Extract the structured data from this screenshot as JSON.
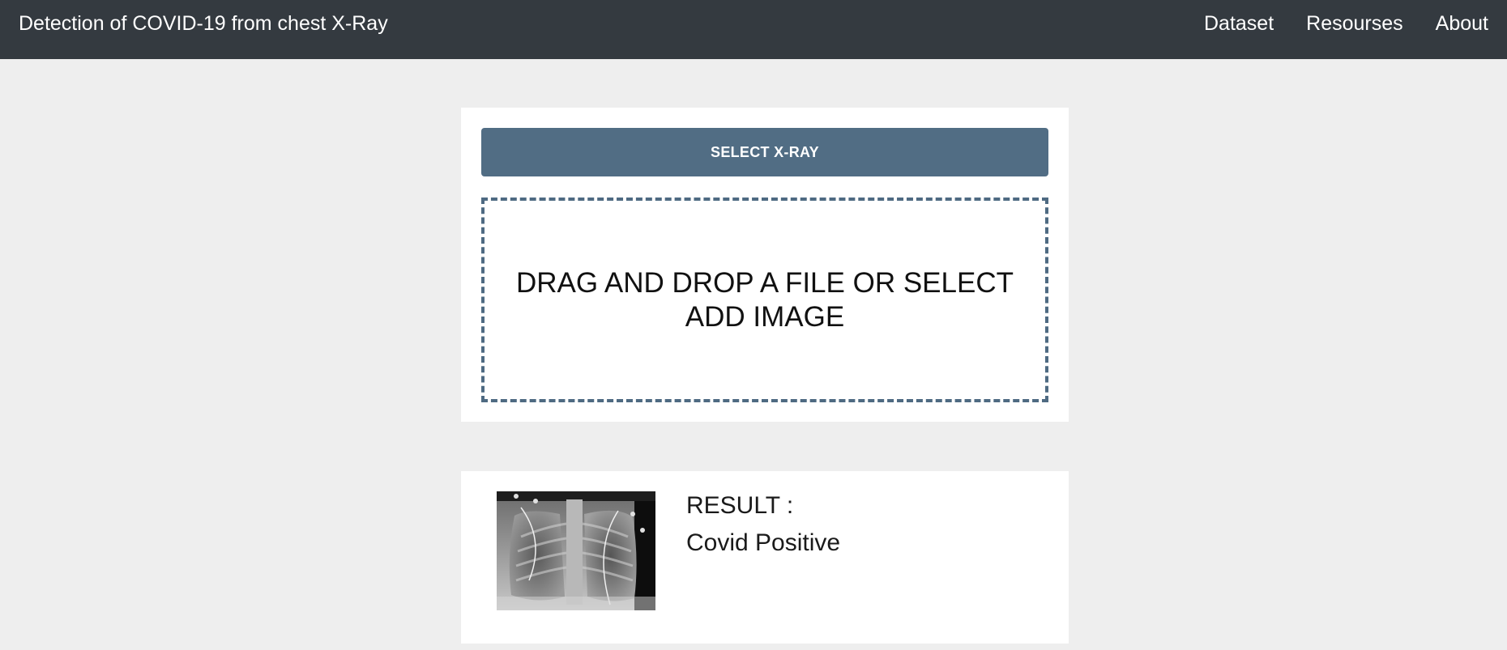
{
  "navbar": {
    "brand": "Detection of COVID-19 from chest X-Ray",
    "links": [
      {
        "label": "Dataset"
      },
      {
        "label": "Resourses"
      },
      {
        "label": "About"
      }
    ],
    "background": "#343a40"
  },
  "upload": {
    "button_label": "SELECT X-RAY",
    "button_color": "#516d84",
    "dropzone_text": "DRAG AND DROP A FILE OR SELECT ADD IMAGE",
    "dropzone_border_color": "#4e6a82"
  },
  "result": {
    "image_icon": "chest-xray-thumbnail",
    "label": "RESULT :",
    "value": "Covid Positive"
  },
  "page": {
    "background": "#eeeeee"
  }
}
